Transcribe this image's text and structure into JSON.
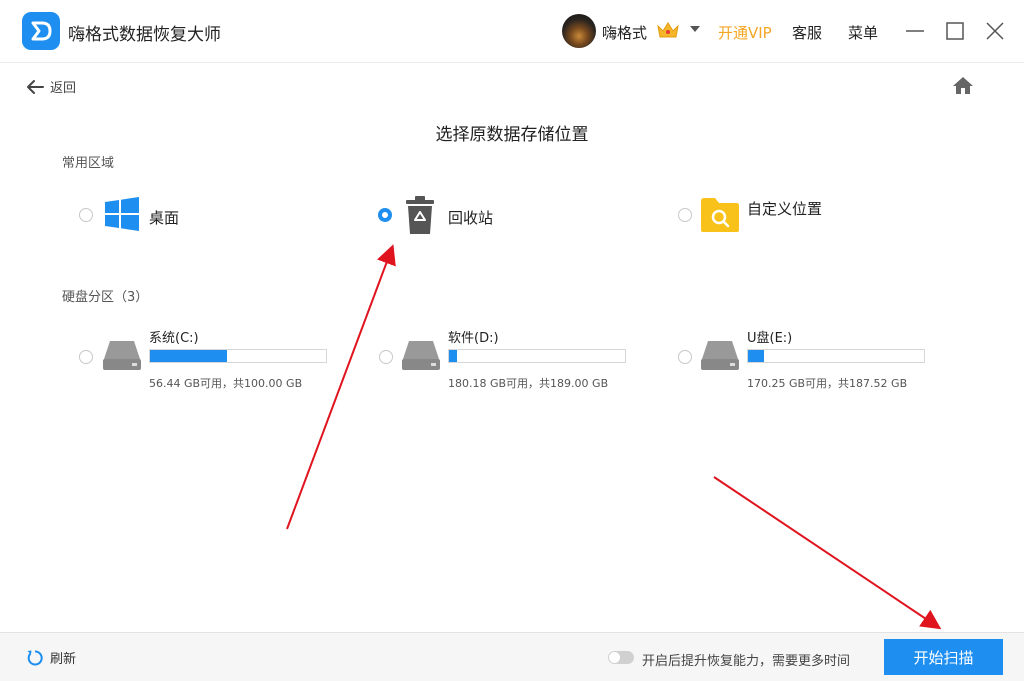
{
  "app": {
    "title": "嗨格式数据恢复大师"
  },
  "user": {
    "name": "嗨格式"
  },
  "header": {
    "vip_label": "开通VIP",
    "service_label": "客服",
    "menu_label": "菜单"
  },
  "nav": {
    "back_label": "返回"
  },
  "page": {
    "title": "选择原数据存储位置"
  },
  "common_area": {
    "label": "常用区域",
    "items": [
      {
        "label": "桌面",
        "selected": false,
        "icon": "windows-icon"
      },
      {
        "label": "回收站",
        "selected": true,
        "icon": "recycle-bin-icon"
      },
      {
        "label": "自定义位置",
        "selected": false,
        "icon": "folder-search-icon"
      }
    ]
  },
  "disks": {
    "label": "硬盘分区（3）",
    "items": [
      {
        "name": "系统(C:)",
        "info": "56.44 GB可用，共100.00 GB",
        "used_fraction": 0.4356
      },
      {
        "name": "软件(D:)",
        "info": "180.18 GB可用，共189.00 GB",
        "used_fraction": 0.0467
      },
      {
        "name": "U盘(E:)",
        "info": "170.25 GB可用，共187.52 GB",
        "used_fraction": 0.0921
      }
    ]
  },
  "footer": {
    "refresh_label": "刷新",
    "toggle_label": "开启后提升恢复能力，需要更多时间",
    "toggle_on": false,
    "start_label": "开始扫描"
  },
  "colors": {
    "accent": "#1e8ff0",
    "vip": "#f5a623",
    "annotation": "#e0141e"
  }
}
